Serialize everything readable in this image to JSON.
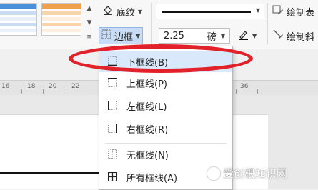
{
  "ribbon": {
    "shading_label": "底纹",
    "border_label": "边框",
    "line_weight_value": "2.25",
    "line_weight_unit": "磅",
    "draw_table_label": "绘制表",
    "draw_diagonal_label": "绘制斜"
  },
  "ruler": {
    "labels": [
      "16",
      "18",
      "20",
      "22",
      "36"
    ]
  },
  "border_menu": {
    "items": [
      {
        "label": "下框线(B)",
        "icon": "bottom-border-icon",
        "highlighted": true
      },
      {
        "label": "上框线(P)",
        "icon": "top-border-icon"
      },
      {
        "label": "左框线(L)",
        "icon": "left-border-icon"
      },
      {
        "label": "右框线(R)",
        "icon": "right-border-icon"
      },
      {
        "label": "无框线(N)",
        "icon": "no-border-icon"
      },
      {
        "label": "所有框线(A)",
        "icon": "all-borders-icon"
      }
    ]
  },
  "annotation": {
    "color": "#e2222a"
  },
  "watermark": {
    "text": "爱创根知识网"
  },
  "colors": {
    "accent_blue": "#c8ddf5",
    "highlight": "#d9e8fb",
    "table_blue": "#4a90d9",
    "table_orange": "#f0a04b"
  }
}
